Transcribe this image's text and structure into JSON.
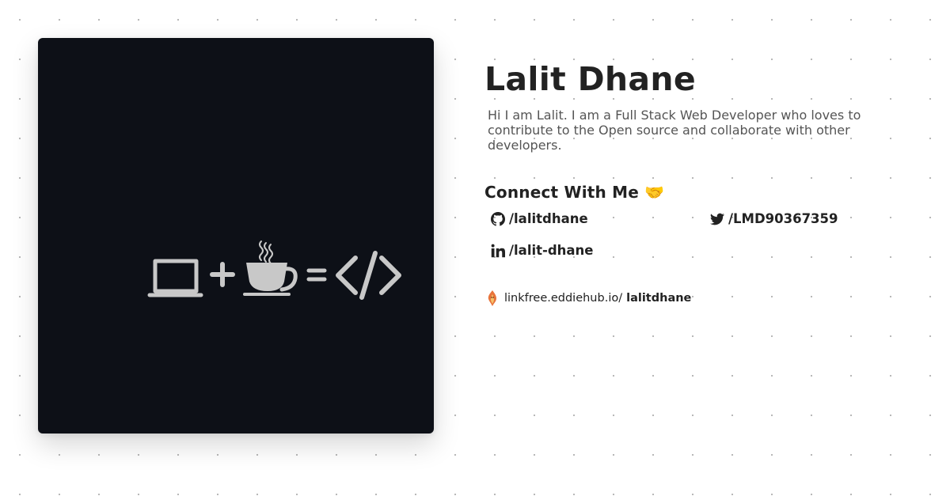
{
  "profile": {
    "name": "Lalit Dhane",
    "bio": "Hi I am Lalit. I am a Full Stack Web Developer who loves to contribute to the Open source and collaborate with other developers.",
    "avatar": {
      "icon": "laptop-plus-coffee-equals-code-icon",
      "background": "#0d1017",
      "foreground": "#c8c8c8"
    }
  },
  "connect": {
    "heading": "Connect With Me 🤝",
    "links": {
      "github": {
        "icon": "github-icon",
        "label": "/lalitdhane"
      },
      "twitter": {
        "icon": "twitter-icon",
        "label": "/LMD90367359"
      },
      "linkedin": {
        "icon": "linkedin-icon",
        "label": "/lalit-dhane"
      }
    }
  },
  "footer": {
    "icon": "linkfree-logo-icon",
    "base_url": "linkfree.eddiehub.io/",
    "handle": "lalitdhane"
  }
}
